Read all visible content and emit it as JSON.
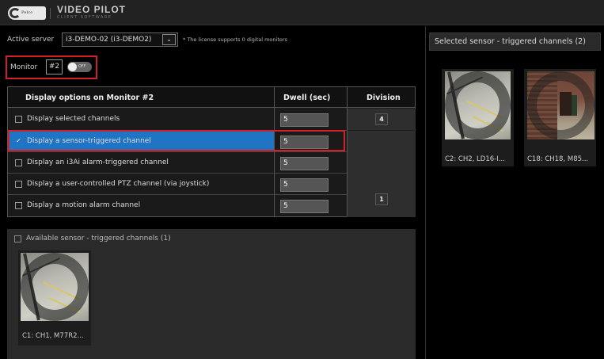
{
  "header": {
    "logo_text": "Pelco",
    "app_title": "VIDEO PILOT",
    "app_subtitle": "CLIENT SOFTWARE"
  },
  "server": {
    "label": "Active server",
    "selected": "i3-DEMO-02 (i3-DEMO2)",
    "dropdown_glyph": "⌄",
    "license_note": "* The license supports 0 digital monitors"
  },
  "monitor": {
    "label": "Monitor",
    "number": "#2",
    "toggle_label": "OFF",
    "toggle_on": false
  },
  "options_table": {
    "columns": [
      "Display options on Monitor #2",
      "Dwell (sec)",
      "Division"
    ],
    "rows": [
      {
        "label": "Display selected channels",
        "checked": false,
        "dwell": "5"
      },
      {
        "label": "Display a sensor-triggered channel",
        "checked": true,
        "dwell": "5"
      },
      {
        "label": "Display an i3Ai alarm-triggered channel",
        "checked": false,
        "dwell": "5"
      },
      {
        "label": "Display a user-controlled PTZ channel (via joystick)",
        "checked": false,
        "dwell": "5"
      },
      {
        "label": "Display a motion alarm channel",
        "checked": false,
        "dwell": "5"
      }
    ],
    "division_values": [
      "4",
      "1"
    ],
    "check_glyph": "✓"
  },
  "available": {
    "title": "Available sensor - triggered channels (1)",
    "channels": [
      {
        "caption": "C1: CH1, M77R2..."
      }
    ]
  },
  "selected_panel": {
    "title": "Selected sensor - triggered channels (2)",
    "channels": [
      {
        "caption": "C2: CH2, LD16-I..."
      },
      {
        "caption": "C18: CH18, M85..."
      }
    ]
  },
  "colors": {
    "highlight_red": "#d0202a",
    "selection_blue": "#1f74c4",
    "background": "#000000",
    "panel": "#2a2a2a"
  }
}
